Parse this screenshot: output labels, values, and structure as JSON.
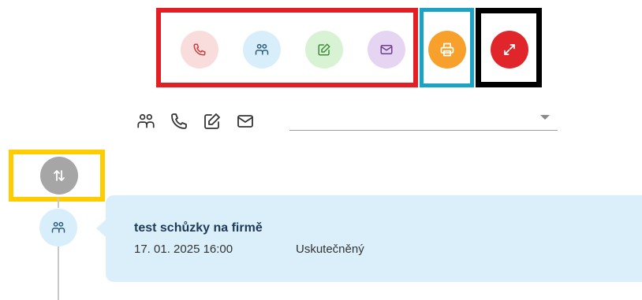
{
  "toolbar": {
    "groups": [
      {
        "name": "activity-type-group",
        "frame_color": "#e31e24"
      },
      {
        "name": "print-group",
        "frame_color": "#1ba3c6"
      },
      {
        "name": "fullscreen-group",
        "frame_color": "#000000"
      }
    ],
    "buttons": [
      {
        "icon": "phone-icon",
        "bg": "#f9dcdc",
        "fg": "#c94040"
      },
      {
        "icon": "meeting-icon",
        "bg": "#d9eefb",
        "fg": "#2c5d7a"
      },
      {
        "icon": "note-edit-icon",
        "bg": "#d8f3d3",
        "fg": "#3f8a3a"
      },
      {
        "icon": "email-icon",
        "bg": "#e6d5f2",
        "fg": "#6e3f8c"
      },
      {
        "icon": "print-icon",
        "bg": "#f7a12c",
        "fg": "#ffffff"
      },
      {
        "icon": "fullscreen-icon",
        "bg": "#e0262b",
        "fg": "#ffffff"
      }
    ]
  },
  "filter": {
    "icons": [
      "meeting-icon",
      "phone-icon",
      "note-edit-icon",
      "email-icon"
    ],
    "select_value": ""
  },
  "timeline": {
    "sort_button": {
      "icon": "sort-updown-icon",
      "bg": "#a6a6a6",
      "frame_color": "#ffcc00"
    },
    "items": [
      {
        "icon": "meeting-icon",
        "title": "test schůzky na firmě",
        "datetime": "17. 01. 2025 16:00",
        "status": "Uskutečněný"
      }
    ]
  }
}
